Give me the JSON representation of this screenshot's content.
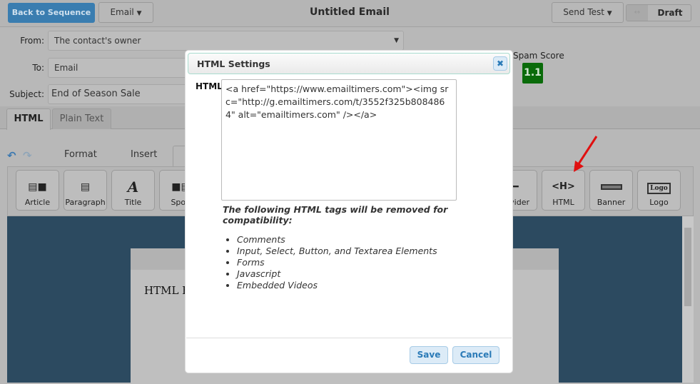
{
  "header": {
    "back_label": "Back to Sequence",
    "type_select": "Email",
    "title": "Untitled Email",
    "send_test_label": "Send Test",
    "status_label": "Draft"
  },
  "form": {
    "from_label": "From:",
    "from_value": "The contact's owner",
    "to_label": "To:",
    "to_value": "Email",
    "subject_label": "Subject:",
    "subject_value": "End of Season Sale",
    "spam_label": "Spam Score",
    "spam_value": "1.1",
    "spam_color": "#0a6b0a"
  },
  "tabs": [
    {
      "label": "HTML",
      "active": true
    },
    {
      "label": "Plain Text",
      "active": false
    }
  ],
  "editor_tabs": {
    "format": "Format",
    "insert": "Insert"
  },
  "toolbar": [
    {
      "label": "Article",
      "icon": "article-icon"
    },
    {
      "label": "Paragraph",
      "icon": "paragraph-icon"
    },
    {
      "label": "Title",
      "icon": "title-icon"
    },
    {
      "label": "Spotl",
      "icon": "spotlight-icon"
    },
    {
      "label": "vider",
      "icon": "divider-icon"
    },
    {
      "label": "HTML",
      "icon": "html-icon"
    },
    {
      "label": "Banner",
      "icon": "banner-icon"
    },
    {
      "label": "Logo",
      "icon": "logo-icon"
    }
  ],
  "canvas": {
    "block_text": "HTML E"
  },
  "modal": {
    "title": "HTML Settings",
    "field_label": "HTML",
    "html_value": "<a href=\"https://www.emailtimers.com\"><img src=\"http://g.emailtimers.com/t/3552f325b8084864\" alt=\"emailtimers.com\" /></a>",
    "note": "The following HTML tags will be removed for compatibility:",
    "removed_tags": [
      "Comments",
      "Input, Select, Button, and Textarea Elements",
      "Forms",
      "Javascript",
      "Embedded Videos"
    ],
    "save_label": "Save",
    "cancel_label": "Cancel"
  }
}
